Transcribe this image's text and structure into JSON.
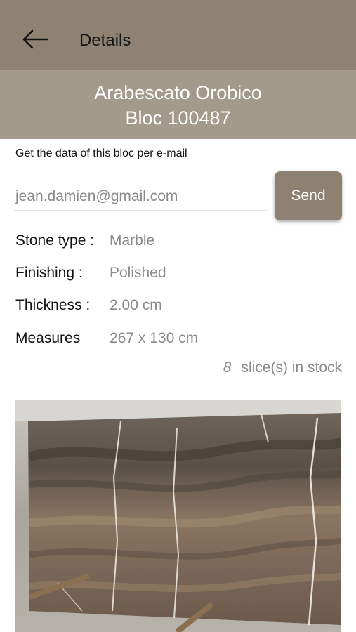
{
  "header": {
    "title": "Details",
    "back_icon": "arrow-left-icon"
  },
  "block": {
    "name": "Arabescato Orobico",
    "bloc": "Bloc 100487"
  },
  "email": {
    "label": "Get the data of this bloc per e-mail",
    "value": "jean.damien@gmail.com",
    "send_label": "Send"
  },
  "properties": [
    {
      "label": "Stone type :",
      "value": "Marble"
    },
    {
      "label": "Finishing :",
      "value": "Polished"
    },
    {
      "label": "Thickness :",
      "value": "2.00 cm"
    },
    {
      "label": "Measures",
      "value": "267 x 130 cm"
    }
  ],
  "stock": {
    "count": "8",
    "label": "slice(s) in stock"
  },
  "colors": {
    "topbar": "#8f8273",
    "titlebar": "#a49a8b",
    "button": "#8e8172"
  }
}
